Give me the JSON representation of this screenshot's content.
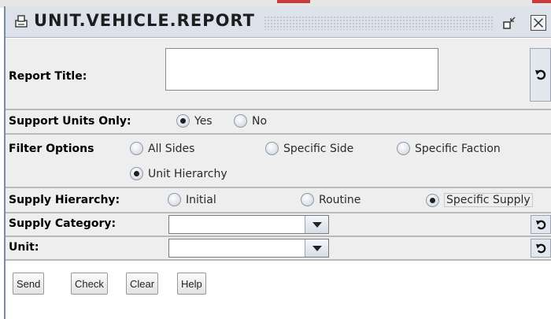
{
  "window": {
    "title": "UNIT.VEHICLE.REPORT",
    "icons": {
      "app": "printer-icon",
      "restore": "restore-icon",
      "close": "close-icon"
    }
  },
  "report_title": {
    "label": "Report Title:",
    "value": ""
  },
  "support_units": {
    "label": "Support Units Only:",
    "options": [
      {
        "label": "Yes",
        "selected": true
      },
      {
        "label": "No",
        "selected": false
      }
    ]
  },
  "filter_options": {
    "label": "Filter Options",
    "options": [
      {
        "label": "All Sides",
        "selected": false
      },
      {
        "label": "Specific Side",
        "selected": false
      },
      {
        "label": "Specific Faction",
        "selected": false
      },
      {
        "label": "Unit Hierarchy",
        "selected": true
      }
    ]
  },
  "supply_hierarchy": {
    "label": "Supply Hierarchy:",
    "options": [
      {
        "label": "Initial",
        "selected": false
      },
      {
        "label": "Routine",
        "selected": false
      },
      {
        "label": "Specific Supply",
        "selected": true
      }
    ]
  },
  "supply_category": {
    "label": "Supply Category:",
    "value": ""
  },
  "unit": {
    "label": "Unit:",
    "value": ""
  },
  "buttons": {
    "send": "Send",
    "check": "Check",
    "clear": "Clear",
    "help": "Help"
  }
}
